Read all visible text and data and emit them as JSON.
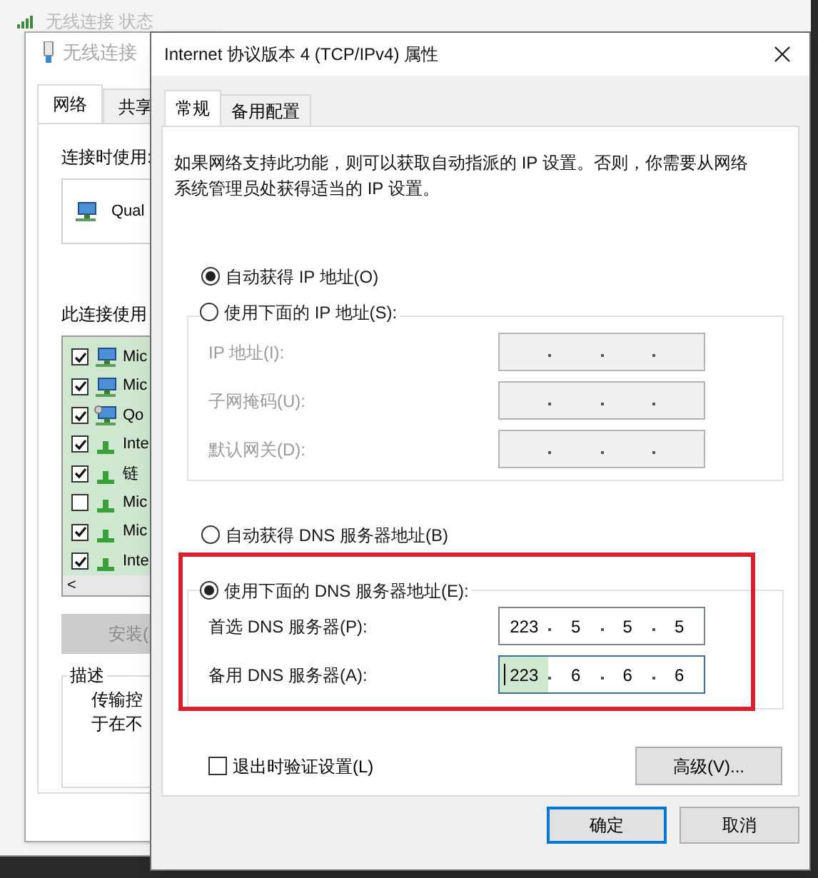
{
  "back_window": {
    "title": "无线连接 状态"
  },
  "properties_window": {
    "title": "无线连接",
    "tabs": [
      {
        "label": "网络",
        "selected": true
      },
      {
        "label": "共享",
        "selected": false
      }
    ],
    "connect_using_label": "连接时使用:",
    "adapter": "Qual",
    "components_label": "此连接使用",
    "components": [
      {
        "label": "Mic",
        "checked": true,
        "kind": "client"
      },
      {
        "label": "Mic",
        "checked": true,
        "kind": "client"
      },
      {
        "label": "Qo",
        "checked": true,
        "kind": "service"
      },
      {
        "label": "Inte",
        "checked": true,
        "kind": "protocol"
      },
      {
        "label": "链",
        "checked": true,
        "kind": "protocol"
      },
      {
        "label": "Mic",
        "checked": false,
        "kind": "protocol"
      },
      {
        "label": "Mic",
        "checked": true,
        "kind": "protocol"
      },
      {
        "label": "Inte",
        "checked": true,
        "kind": "protocol"
      }
    ],
    "scroll_left": "<",
    "install_button": "安装(",
    "description": {
      "title": "描述",
      "lines": [
        "传输控",
        "于在不"
      ]
    }
  },
  "dialog": {
    "title": "Internet 协议版本 4 (TCP/IPv4) 属性",
    "tabs": [
      {
        "label": "常规",
        "selected": true
      },
      {
        "label": "备用配置",
        "selected": false
      }
    ],
    "intro": "如果网络支持此功能，则可以获取自动指派的 IP 设置。否则，你需要从网络系统管理员处获得适当的 IP 设置。",
    "ip_options": [
      {
        "label": "自动获得 IP 地址(O)",
        "selected": true
      },
      {
        "label": "使用下面的 IP 地址(S):",
        "selected": false
      }
    ],
    "ip_fields": [
      {
        "label": "IP 地址(I):",
        "disabled": true,
        "focused": false
      },
      {
        "label": "子网掩码(U):",
        "disabled": true,
        "focused": false
      },
      {
        "label": "默认网关(D):",
        "disabled": true,
        "focused": false
      }
    ],
    "dns_options": [
      {
        "label": "自动获得 DNS 服务器地址(B)",
        "selected": false
      },
      {
        "label": "使用下面的 DNS 服务器地址(E):",
        "selected": true
      }
    ],
    "dns_fields": [
      {
        "label": "首选 DNS 服务器(P):",
        "disabled": false,
        "focused": false,
        "octets": [
          "223",
          "5",
          "5",
          "5"
        ]
      },
      {
        "label": "备用 DNS 服务器(A):",
        "disabled": false,
        "focused": true,
        "octets": [
          "223",
          "6",
          "6",
          "6"
        ]
      }
    ],
    "validate_checkbox": {
      "label": "退出时验证设置(L)",
      "checked": false
    },
    "advanced_button": "高级(V)...",
    "buttons": [
      {
        "label": "确定",
        "default": true
      },
      {
        "label": "取消",
        "default": false
      }
    ]
  }
}
